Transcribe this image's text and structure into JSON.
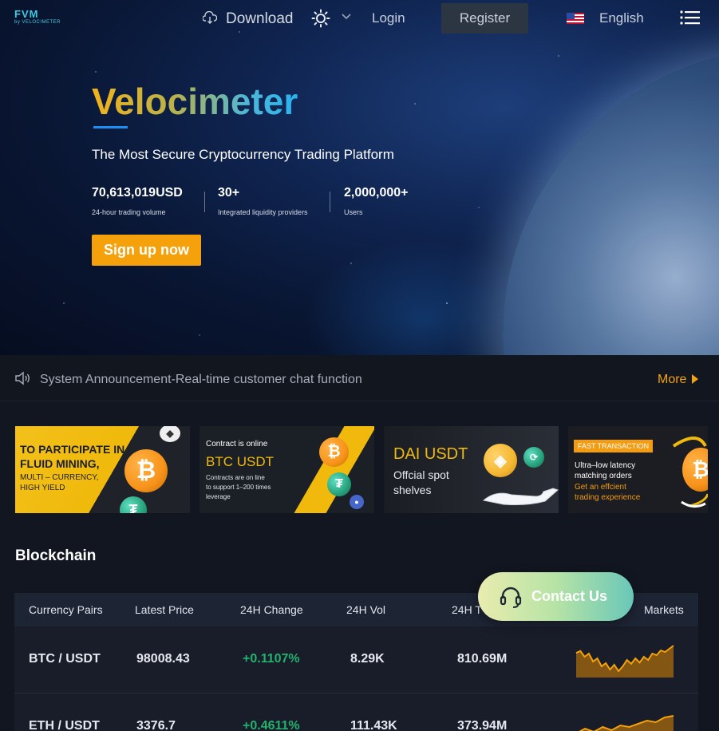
{
  "nav": {
    "logo_main": "FVM",
    "logo_sub": "by VELOCIMETER",
    "download": "Download",
    "login": "Login",
    "register": "Register",
    "language": "English",
    "icons": [
      "cloud-download-icon",
      "sun-icon",
      "chevron-down-icon",
      "us-flag-icon",
      "menu-icon"
    ]
  },
  "hero": {
    "title": "Velocimeter",
    "subtitle": "The Most Secure Cryptocurrency Trading Platform",
    "stats": [
      {
        "value": "70,613,019USD",
        "label": "24-hour trading volume"
      },
      {
        "value": "30+",
        "label": "Integrated liquidity providers"
      },
      {
        "value": "2,000,000+",
        "label": "Users"
      }
    ],
    "cta": "Sign up now"
  },
  "announcement": {
    "text": "System Announcement-Real-time customer chat function",
    "more": "More"
  },
  "banners": [
    {
      "line1": "TO PARTICIPATE IN",
      "line2": "FLUID MINING,",
      "line3": "MULTI – CURRENCY,",
      "line4": "HIGH YIELD"
    },
    {
      "line1": "Contract is online",
      "line2": "BTC USDT",
      "line3": "Contracts are on line",
      "line4": "to support 1–200 times",
      "line5": "leverage"
    },
    {
      "line1": "DAI USDT",
      "line2": "Offcial spot",
      "line3": "shelves"
    },
    {
      "tag": "FAST TRANSACTION",
      "line1": "Ultra–low latency",
      "line2": "matching orders",
      "line3": "Get an effcient",
      "line4": "trading experience"
    }
  ],
  "blockchain": {
    "title": "Blockchain",
    "headers": [
      "Currency Pairs",
      "Latest Price",
      "24H Change",
      "24H Vol",
      "24H T",
      "Markets"
    ],
    "rows": [
      {
        "pair": "BTC / USDT",
        "price": "98008.43",
        "change": "+0.1107%",
        "vol": "8.29K",
        "turnover": "810.69M",
        "trend": [
          0.72,
          0.78,
          0.6,
          0.7,
          0.45,
          0.55,
          0.3,
          0.4,
          0.2,
          0.35,
          0.15,
          0.3,
          0.5,
          0.38,
          0.55,
          0.42,
          0.6,
          0.5,
          0.7,
          0.65,
          0.8,
          0.75,
          0.85,
          0.95
        ]
      },
      {
        "pair": "ETH / USDT",
        "price": "3376.7",
        "change": "+0.4611%",
        "vol": "111.43K",
        "turnover": "373.94M",
        "trend": [
          0.3,
          0.45,
          0.35,
          0.5,
          0.4,
          0.55,
          0.5,
          0.6,
          0.7,
          0.65,
          0.8,
          0.85
        ]
      }
    ]
  },
  "contact": {
    "label": "Contact Us"
  },
  "colors": {
    "accent": "#f5a10b",
    "positive": "#23b26d",
    "link": "#1d8ff0"
  }
}
